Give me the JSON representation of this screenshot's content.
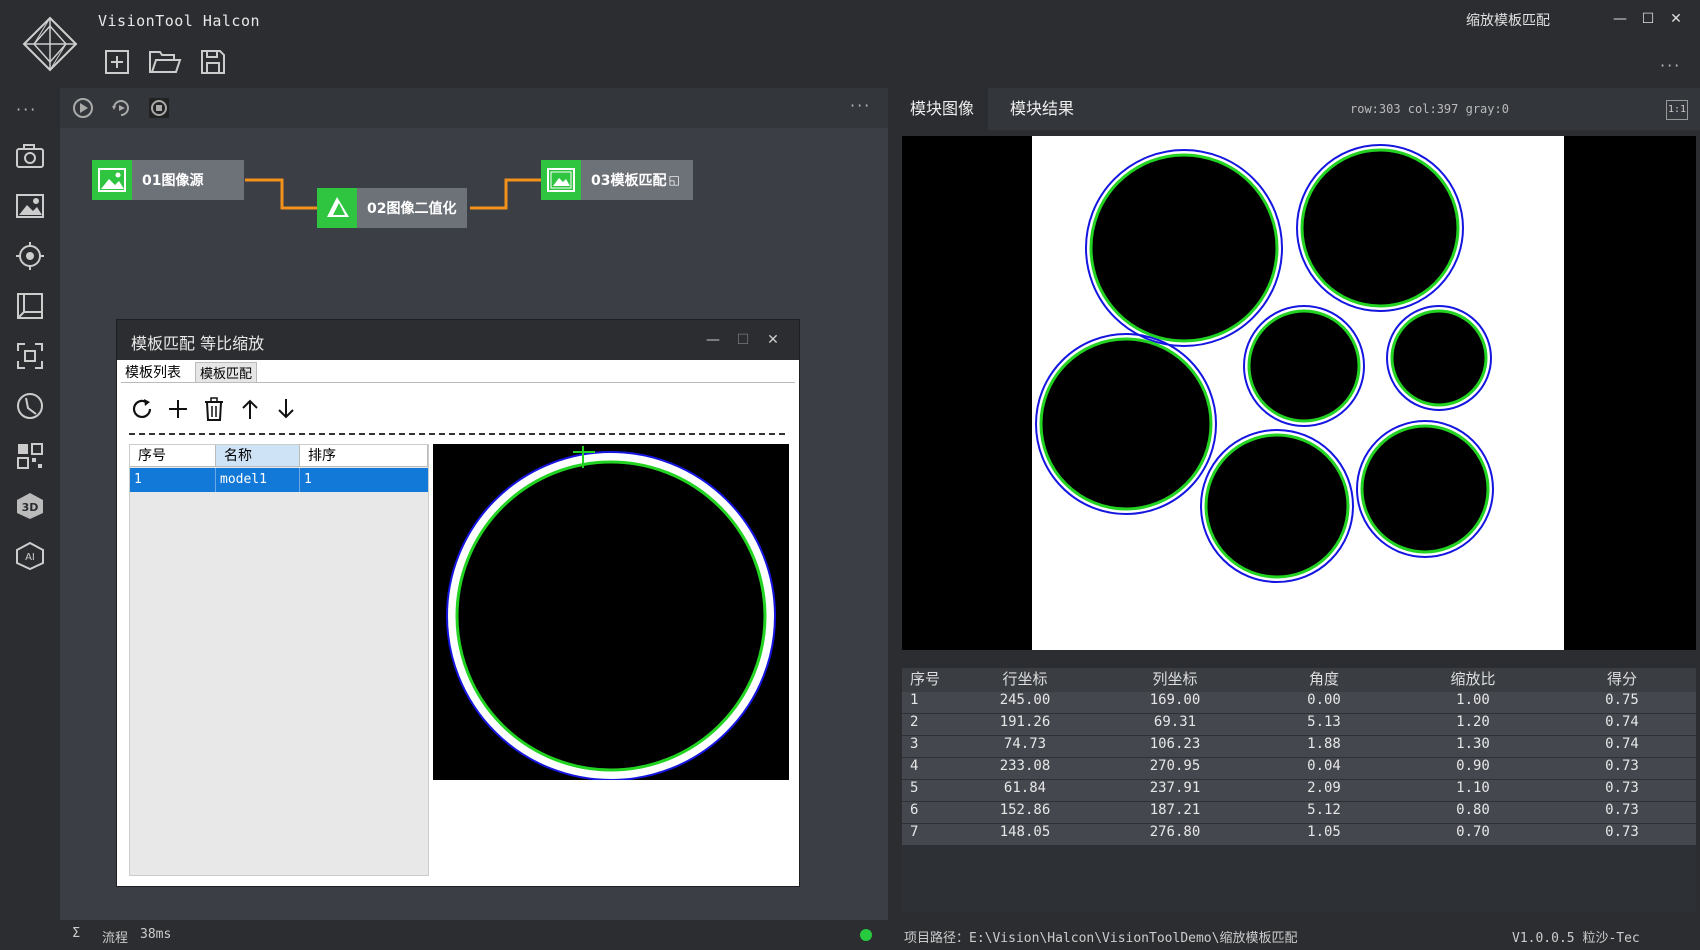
{
  "app": {
    "title": "VisionTool Halcon",
    "window_caption": "缩放模板匹配"
  },
  "toolbar": {
    "new_icon": "new-file-icon",
    "open_icon": "open-folder-icon",
    "save_icon": "save-icon",
    "more": "···"
  },
  "sidebar": {
    "more": "···",
    "icons": [
      "camera-icon",
      "image-settings-icon",
      "target-icon",
      "layers-icon",
      "capture-icon",
      "measure-icon",
      "qrcode-icon",
      "3d-icon",
      "ai-icon"
    ],
    "ai_label": "AI",
    "3d_label": "3D"
  },
  "flow": {
    "toolbar_more": "···",
    "nodes": [
      {
        "label": "01图像源"
      },
      {
        "label": "02图像二值化"
      },
      {
        "label": "03模板匹配"
      }
    ],
    "connector_color": "#f2911b",
    "node_icon_color": "#2fc540"
  },
  "dialog": {
    "title": "模板匹配  等比缩放",
    "tabs": [
      "模板列表",
      "模板匹配"
    ],
    "list_headers": [
      "序号",
      "名称",
      "排序"
    ],
    "list_rows": [
      {
        "index": "1",
        "name": "model1",
        "order": "1"
      }
    ]
  },
  "right": {
    "tabs": [
      "模块图像",
      "模块结果"
    ],
    "coords": "row:303 col:397 gray:0",
    "scale_label": "1:1",
    "results_headers": [
      "序号",
      "行坐标",
      "列坐标",
      "角度",
      "缩放比",
      "得分"
    ],
    "results": [
      [
        "1",
        "245.00",
        "169.00",
        "0.00",
        "1.00",
        "0.75"
      ],
      [
        "2",
        "191.26",
        "69.31",
        "5.13",
        "1.20",
        "0.74"
      ],
      [
        "3",
        "74.73",
        "106.23",
        "1.88",
        "1.30",
        "0.74"
      ],
      [
        "4",
        "233.08",
        "270.95",
        "0.04",
        "0.90",
        "0.73"
      ],
      [
        "5",
        "61.84",
        "237.91",
        "2.09",
        "1.10",
        "0.73"
      ],
      [
        "6",
        "152.86",
        "187.21",
        "5.12",
        "0.80",
        "0.73"
      ],
      [
        "7",
        "148.05",
        "276.80",
        "1.05",
        "0.70",
        "0.73"
      ]
    ]
  },
  "status": {
    "flow_label": "流程",
    "flow_time": "38ms",
    "sigma": "Σ",
    "project_path": "项目路径：E:\\Vision\\Halcon\\VisionToolDemo\\缩放模板匹配",
    "version": "V1.0.0.5 粒沙-Tec",
    "status_color": "#27c93f"
  }
}
